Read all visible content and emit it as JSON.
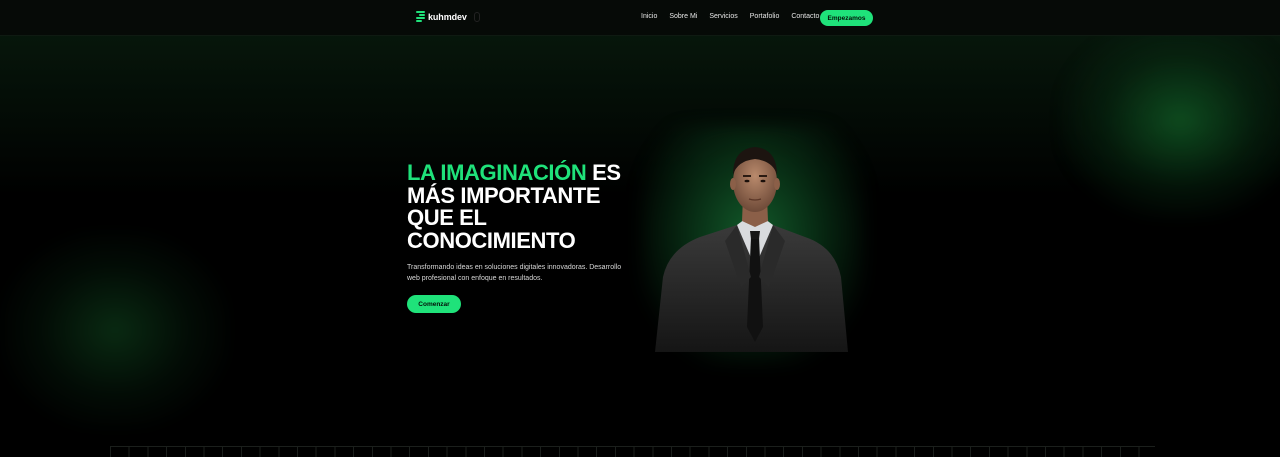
{
  "brand": {
    "name": "kuhmdev",
    "accent": "#1fe27a"
  },
  "nav": {
    "items": [
      "Inicio",
      "Sobre Mi",
      "Servicios",
      "Portafolio",
      "Contacto"
    ],
    "cta_label": "Empezamos"
  },
  "hero": {
    "headline_accent": "LA IMAGINACIÓN",
    "headline_rest": " ES MÁS IMPORTANTE QUE EL CONOCIMIENTO",
    "subtitle": "Transformando ideas en soluciones digitales innovadoras. Desarrollo web profesional con enfoque en resultados.",
    "cta_label": "Comenzar"
  }
}
